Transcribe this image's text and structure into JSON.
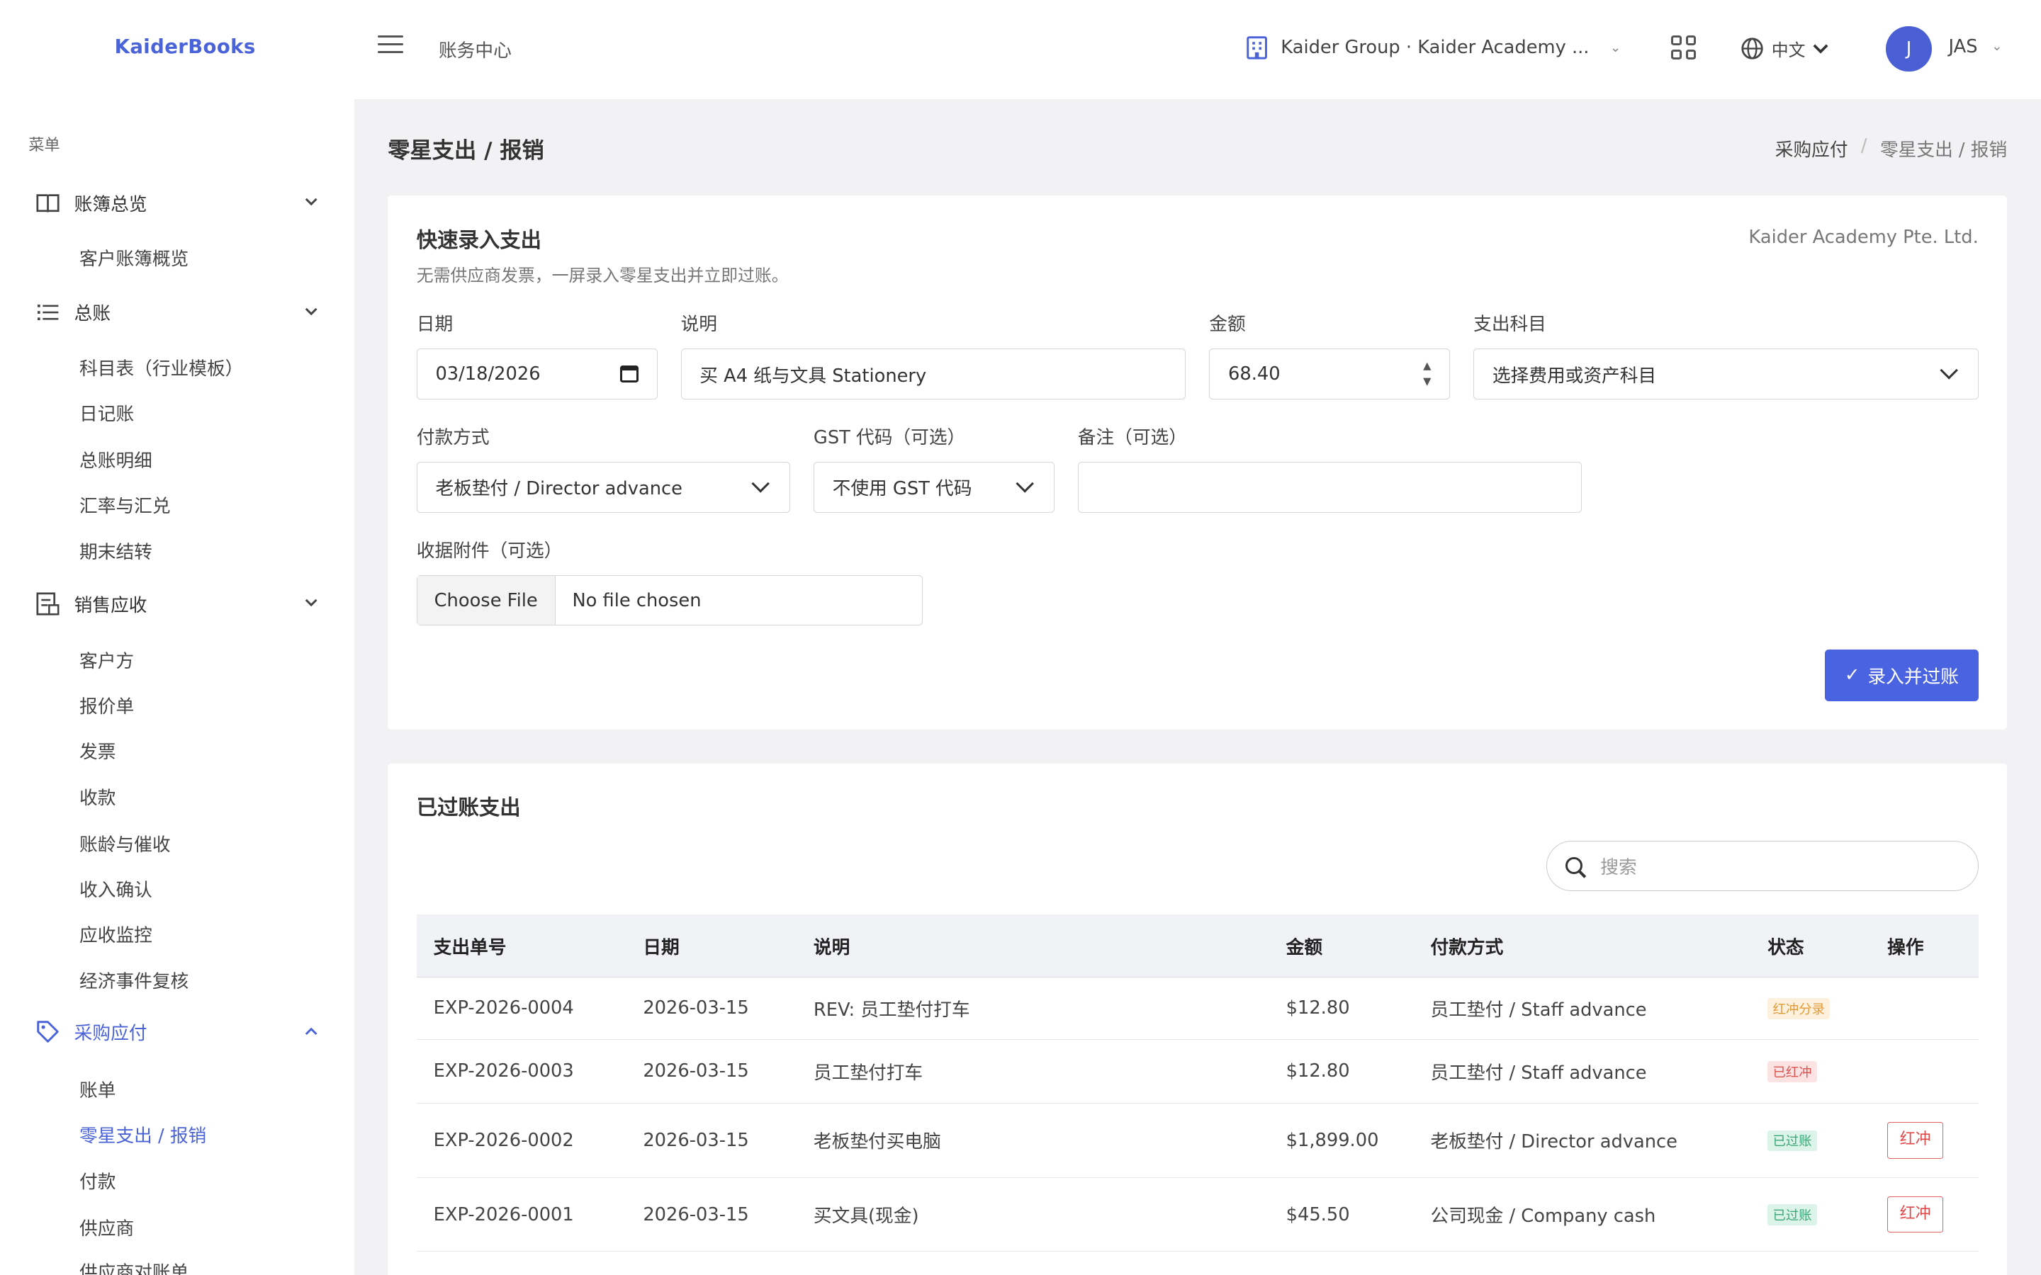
{
  "app": {
    "brand": "KaiderBooks",
    "section": "账务中心"
  },
  "header": {
    "org_name": "Kaider Group · Kaider Academy ...",
    "language": "中文",
    "user_initial": "J",
    "user_name": "JAS"
  },
  "sidebar": {
    "menu_label": "菜单",
    "sections": [
      {
        "label": "账簿总览",
        "icon": "book-icon",
        "items": [
          "客户账簿概览"
        ]
      },
      {
        "label": "总账",
        "icon": "list-icon",
        "items": [
          "科目表（行业模板）",
          "日记账",
          "总账明细",
          "汇率与汇兑",
          "期末结转"
        ]
      },
      {
        "label": "销售应收",
        "icon": "invoice-icon",
        "items": [
          "客户方",
          "报价单",
          "发票",
          "收款",
          "账龄与催收",
          "收入确认",
          "应收监控",
          "经济事件复核"
        ]
      },
      {
        "label": "采购应付",
        "icon": "tag-icon",
        "items": [
          "账单",
          "零星支出 / 报销",
          "付款",
          "供应商",
          "供应商对账单"
        ]
      }
    ]
  },
  "page": {
    "title": "零星支出 / 报销",
    "breadcrumb": [
      "采购应付",
      "零星支出 / 报销"
    ]
  },
  "quick_entry": {
    "title": "快速录入支出",
    "subtitle": "无需供应商发票，一屏录入零星支出并立即过账。",
    "company": "Kaider Academy Pte. Ltd.",
    "date_label": "日期",
    "date_value": "03/18/2026",
    "desc_label": "说明",
    "desc_value": "买 A4 纸与文具 Stationery",
    "amount_label": "金额",
    "amount_value": "68.40",
    "account_label": "支出科目",
    "account_value": "选择费用或资产科目",
    "payment_label": "付款方式",
    "payment_value": "老板垫付 / Director advance",
    "gst_label": "GST 代码（可选）",
    "gst_value": "不使用 GST 代码",
    "note_label": "备注（可选）",
    "note_value": "",
    "attach_label": "收据附件（可选）",
    "file_button": "Choose File",
    "file_status": "No file chosen",
    "submit_label": "录入并过账"
  },
  "posted": {
    "title": "已过账支出",
    "search_placeholder": "搜索",
    "columns": [
      "支出单号",
      "日期",
      "说明",
      "金额",
      "付款方式",
      "状态",
      "操作"
    ],
    "rows": [
      {
        "id": "EXP-2026-0004",
        "date": "2026-03-15",
        "desc": "REV: 员工垫付打车",
        "amount": "$12.80",
        "payment": "员工垫付 / Staff advance",
        "status": "红冲分录",
        "action": ""
      },
      {
        "id": "EXP-2026-0003",
        "date": "2026-03-15",
        "desc": "员工垫付打车",
        "amount": "$12.80",
        "payment": "员工垫付 / Staff advance",
        "status": "已红冲",
        "action": ""
      },
      {
        "id": "EXP-2026-0002",
        "date": "2026-03-15",
        "desc": "老板垫付买电脑",
        "amount": "$1,899.00",
        "payment": "老板垫付 / Director advance",
        "status": "已过账",
        "action": "红冲"
      },
      {
        "id": "EXP-2026-0001",
        "date": "2026-03-15",
        "desc": "买文具(现金)",
        "amount": "$45.50",
        "payment": "公司现金 / Company cash",
        "status": "已过账",
        "action": "红冲"
      }
    ]
  },
  "colors": {
    "accent": "#4a63e0",
    "link": "#4b63d9",
    "danger": "#e04848",
    "success": "#3aa676",
    "warning": "#e39b39"
  }
}
